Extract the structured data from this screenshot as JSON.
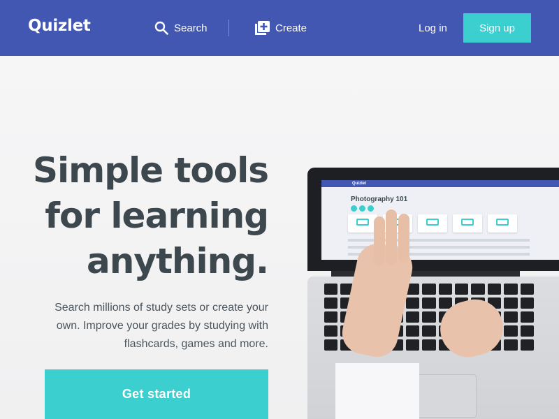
{
  "header": {
    "logo": "Quizlet",
    "search_label": "Search",
    "create_label": "Create",
    "login_label": "Log in",
    "signup_label": "Sign up"
  },
  "hero": {
    "headline_lines": [
      "Simple tools",
      "for learning",
      "anything."
    ],
    "subtext": "Search millions of study sets or create your own. Improve your grades by studying with flashcards, games and more.",
    "cta_label": "Get started"
  },
  "laptop_screen": {
    "app_name": "Quizlet",
    "set_title": "Photography 101"
  },
  "colors": {
    "header_bg": "#4257b2",
    "accent": "#3ccfcf",
    "headline": "#3d474e"
  },
  "icons": {
    "search": "search-icon",
    "create": "create-icon"
  }
}
